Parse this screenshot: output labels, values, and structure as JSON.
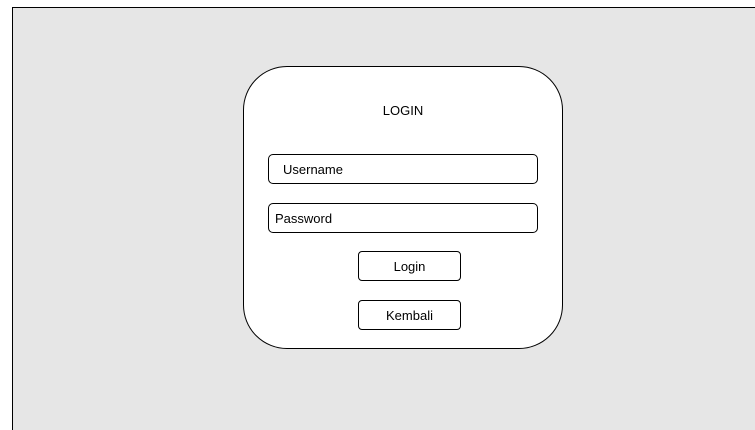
{
  "login_form": {
    "title": "LOGIN",
    "username_placeholder": "Username",
    "password_placeholder": "Password",
    "login_label": "Login",
    "back_label": "Kembali"
  },
  "colors": {
    "canvas_background": "#e6e6e6",
    "card_background": "#ffffff",
    "border": "#000000",
    "text": "#000000"
  }
}
